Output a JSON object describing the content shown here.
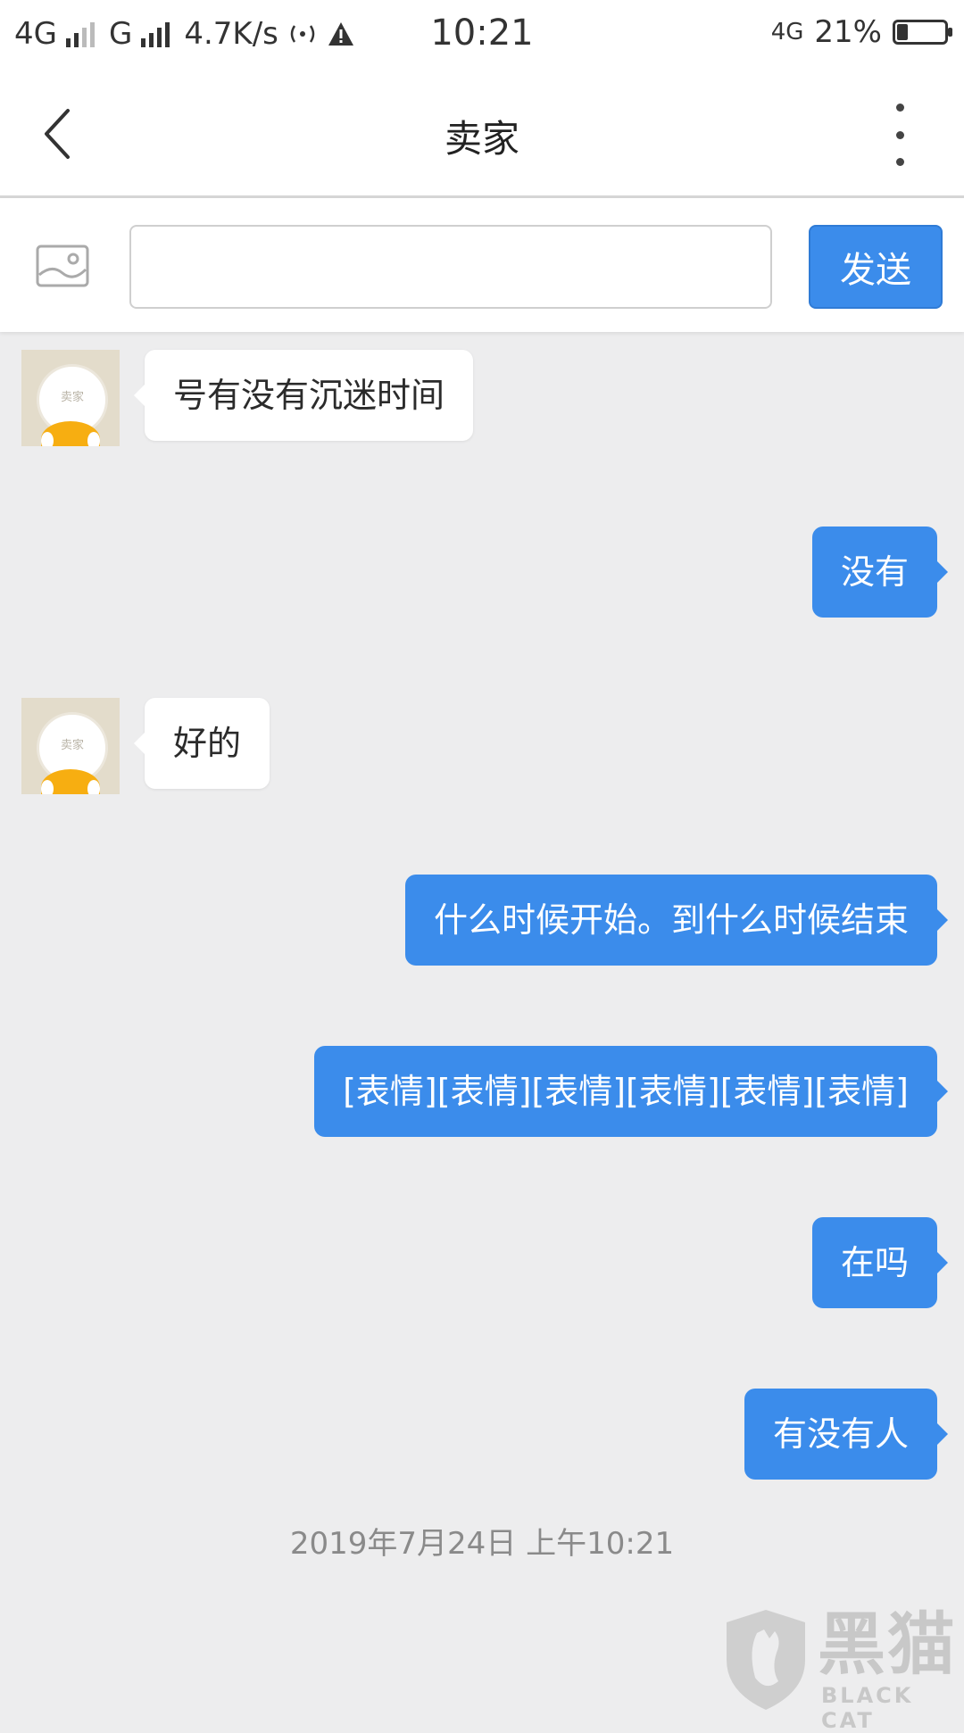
{
  "status_bar": {
    "network1": "4G",
    "network2": "G",
    "speed": "4.7K/s",
    "time": "10:21",
    "lte": "4G",
    "battery_text": "21%",
    "battery_level": 0.21
  },
  "header": {
    "title": "卖家"
  },
  "input_bar": {
    "input_value": "",
    "send_label": "发送"
  },
  "avatar_label": "卖家",
  "messages": [
    {
      "side": "left",
      "text": "号有没有沉迷时间"
    },
    {
      "side": "right",
      "text": "没有"
    },
    {
      "side": "left",
      "text": "好的"
    },
    {
      "side": "right",
      "text": "什么时候开始。到什么时候结束"
    },
    {
      "side": "right",
      "text": "[表情][表情][表情][表情][表情][表情]"
    },
    {
      "side": "right",
      "text": "在吗"
    },
    {
      "side": "right",
      "text": "有没有人"
    }
  ],
  "timestamp": "2019年7月24日 上午10:21",
  "watermark": {
    "cn": "黑猫",
    "en": "BLACK CAT"
  }
}
